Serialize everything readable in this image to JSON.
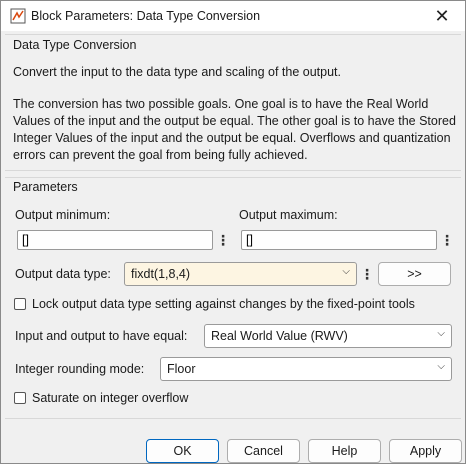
{
  "window": {
    "title": "Block Parameters: Data Type Conversion",
    "close_glyph": "✕"
  },
  "description": {
    "panel_title": "Data Type Conversion",
    "paragraph1": "Convert the input to the data type and scaling of the output.",
    "paragraph2": "The conversion has two possible goals. One goal is to have the Real World Values of the input and the output be equal.  The other goal is to have the Stored Integer Values of the input and the output be equal.  Overflows and quantization errors can prevent the goal from being fully achieved."
  },
  "parameters": {
    "panel_title": "Parameters",
    "output_minimum": {
      "label": "Output minimum:",
      "value": "[]"
    },
    "output_maximum": {
      "label": "Output maximum:",
      "value": "[]"
    },
    "output_data_type": {
      "label": "Output data type:",
      "value": "fixdt(1,8,4)",
      "assistant_label": ">>"
    },
    "lock_checkbox": {
      "label": "Lock output data type setting against changes by the fixed-point tools",
      "checked": false
    },
    "equal_mode": {
      "label": "Input and output to have equal:",
      "value": "Real World Value (RWV)"
    },
    "rounding_mode": {
      "label": "Integer rounding mode:",
      "value": "Floor"
    },
    "saturate_checkbox": {
      "label": "Saturate on integer overflow",
      "checked": false
    }
  },
  "buttons": {
    "ok": "OK",
    "cancel": "Cancel",
    "help": "Help",
    "apply": "Apply"
  },
  "icons": {
    "kebab_glyph": "⋮",
    "dropdown_glyph": "⌵"
  },
  "colors": {
    "data_type_field_bg": "#fdf5e2",
    "ok_border": "#0067c0"
  }
}
